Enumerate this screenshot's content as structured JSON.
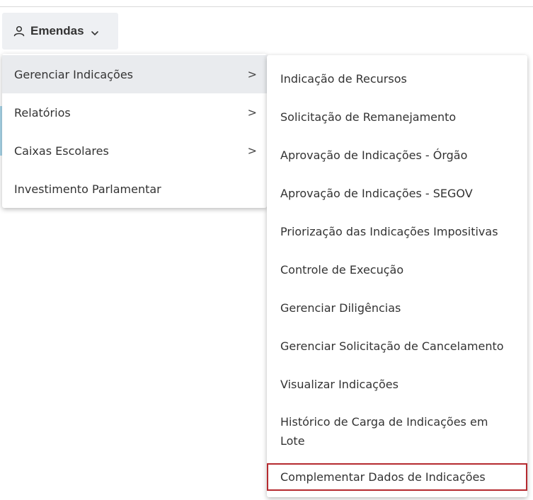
{
  "menu_button": {
    "label": "Emendas",
    "icon": "user-icon",
    "chevron": "chevron-down-icon"
  },
  "menu_level1": {
    "items": [
      {
        "label": "Gerenciar Indicações",
        "has_submenu": true,
        "active": true
      },
      {
        "label": "Relatórios",
        "has_submenu": true,
        "active": false
      },
      {
        "label": "Caixas Escolares",
        "has_submenu": true,
        "active": false
      },
      {
        "label": "Investimento Parlamentar",
        "has_submenu": false,
        "active": false
      }
    ],
    "arrow_glyph": ">"
  },
  "menu_level2": {
    "items": [
      {
        "label": "Indicação de Recursos"
      },
      {
        "label": "Solicitação de Remanejamento"
      },
      {
        "label": "Aprovação de Indicações - Órgão"
      },
      {
        "label": "Aprovação de Indicações - SEGOV"
      },
      {
        "label": "Priorização das Indicações Impositivas"
      },
      {
        "label": "Controle de Execução"
      },
      {
        "label": "Gerenciar Diligências"
      },
      {
        "label": "Gerenciar Solicitação de Cancelamento"
      },
      {
        "label": "Visualizar Indicações"
      },
      {
        "label": "Histórico de Carga de Indicações em Lote"
      },
      {
        "label": "Complementar Dados de Indicações",
        "highlighted": true
      }
    ]
  },
  "colors": {
    "highlight_border": "#b52a2f",
    "active_bg": "#e9ebee",
    "button_bg": "#eef0f3"
  }
}
